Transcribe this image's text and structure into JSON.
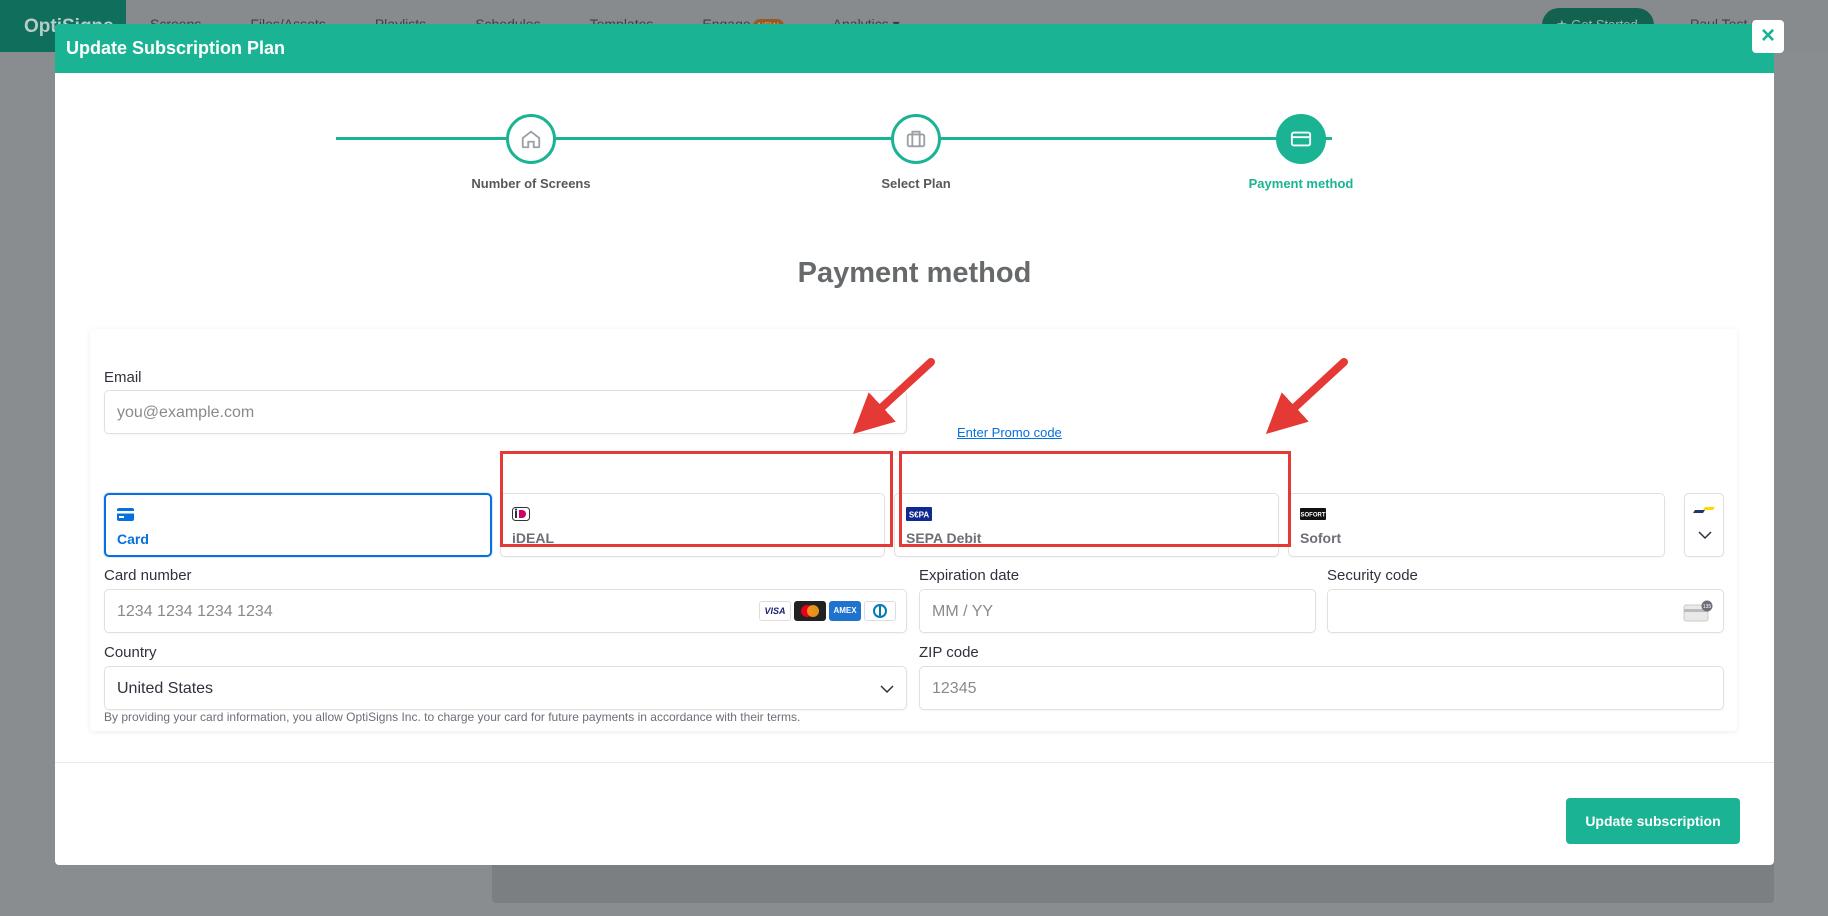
{
  "background": {
    "logo": "OptiSigns",
    "nav": [
      "Screens",
      "Files/Assets",
      "Playlists",
      "Schedules",
      "Templates",
      "Engage"
    ],
    "engage_badge": "NEW",
    "analytics": "Analytics",
    "get_started": "Get Started",
    "user": "Paul Test"
  },
  "modal": {
    "title": "Update Subscription Plan",
    "close": "×"
  },
  "stepper": {
    "steps": [
      {
        "label": "Number of Screens",
        "icon": "home-icon",
        "state": "complete"
      },
      {
        "label": "Select Plan",
        "icon": "briefcase-icon",
        "state": "complete"
      },
      {
        "label": "Payment method",
        "icon": "credit-card-icon",
        "state": "active"
      }
    ]
  },
  "section_title": "Payment method",
  "form": {
    "email_label": "Email",
    "email_placeholder": "you@example.com",
    "promo_link": "Enter Promo code",
    "payment_tabs": [
      {
        "label": "Card",
        "icon": "card-icon",
        "selected": true
      },
      {
        "label": "iDEAL",
        "icon": "ideal-logo-icon",
        "selected": false
      },
      {
        "label": "SEPA Debit",
        "icon": "sepa-logo-icon",
        "selected": false
      },
      {
        "label": "Sofort",
        "icon": "sofort-logo-icon",
        "selected": false
      }
    ],
    "card_number_label": "Card number",
    "card_number_placeholder": "1234 1234 1234 1234",
    "card_brands": [
      "VISA",
      "Mastercard",
      "AMEX",
      "Diners"
    ],
    "expiration_label": "Expiration date",
    "expiration_placeholder": "MM / YY",
    "security_label": "Security code",
    "country_label": "Country",
    "country_value": "United States",
    "zip_label": "ZIP code",
    "zip_placeholder": "12345",
    "disclaimer": "By providing your card information, you allow OptiSigns Inc. to charge your card for future payments in accordance with their terms."
  },
  "footer": {
    "update_button": "Update subscription"
  },
  "colors": {
    "accent": "#1ab394",
    "stripe_blue": "#0570de",
    "annotation_red": "#e53935"
  }
}
